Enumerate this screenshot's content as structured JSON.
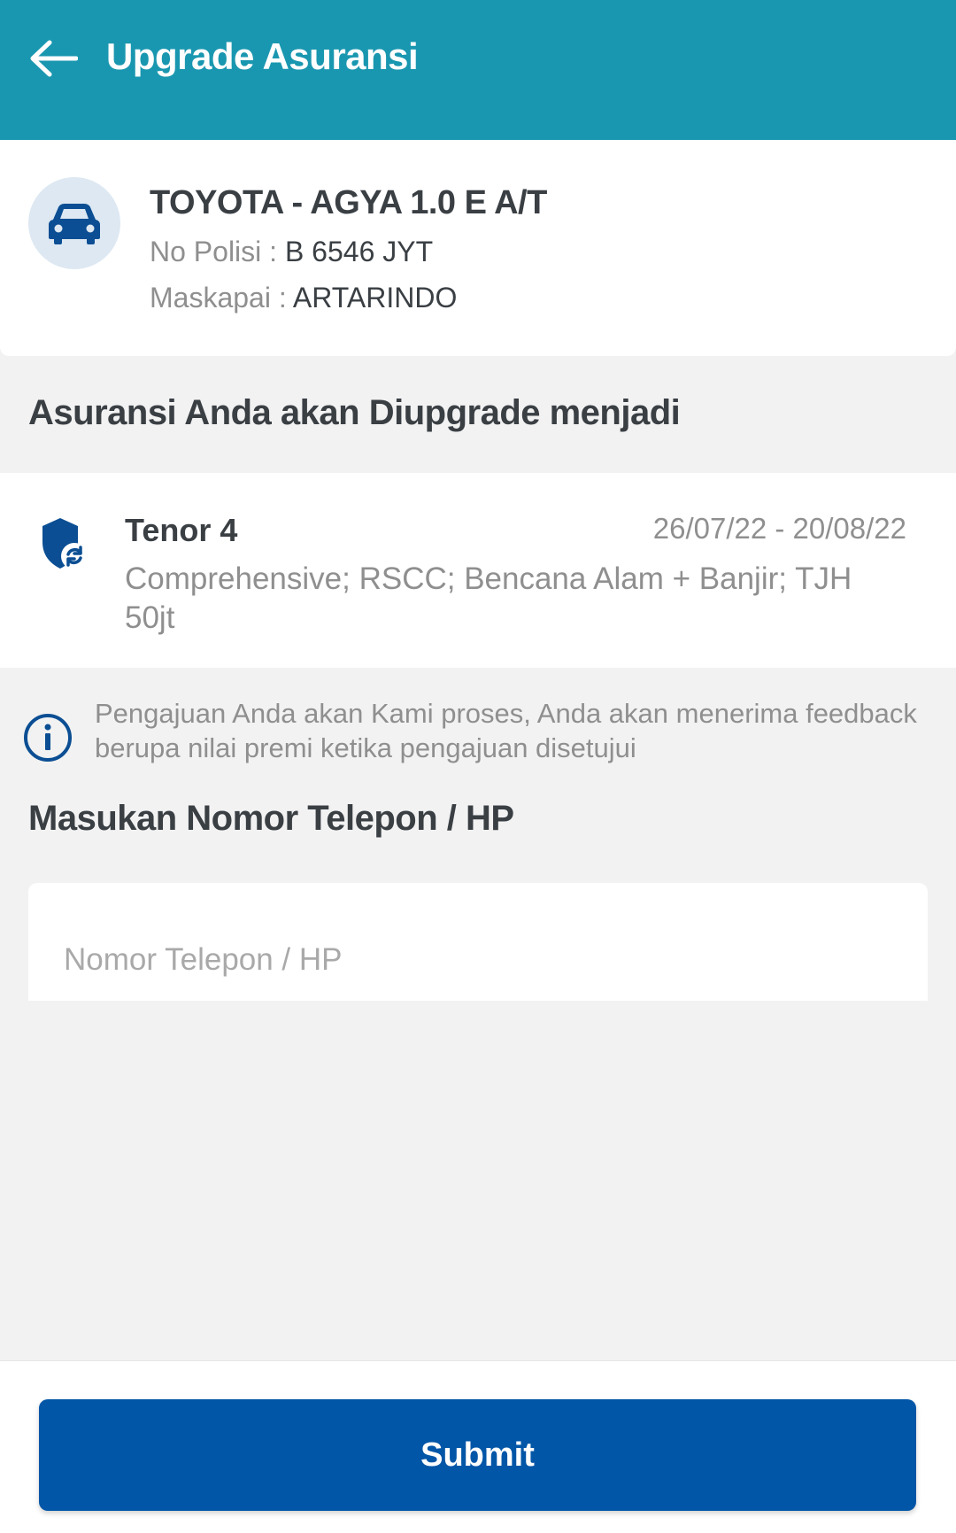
{
  "header": {
    "title": "Upgrade Asuransi",
    "background_color": "#1a97b0"
  },
  "vehicle": {
    "name": "TOYOTA - AGYA 1.0 E A/T",
    "polisi_label": "No Polisi : ",
    "polisi_value": "B 6546 JYT",
    "maskapai_label": "Maskapai : ",
    "maskapai_value": "ARTARINDO",
    "icon": "car-icon"
  },
  "upgrade_section": {
    "title": "Asuransi Anda akan Diupgrade menjadi"
  },
  "plan": {
    "title": "Tenor 4",
    "dates": "26/07/22 - 20/08/22",
    "description": "Comprehensive; RSCC; Bencana Alam + Banjir; TJH 50jt",
    "icon": "shield-refresh-icon"
  },
  "info": {
    "text": "Pengajuan Anda akan Kami proses, Anda akan menerima feedback berupa nilai premi ketika pengajuan disetujui",
    "icon": "info-icon"
  },
  "phone": {
    "label": "Masukan Nomor Telepon / HP",
    "placeholder": "Nomor Telepon / HP",
    "value": ""
  },
  "footer": {
    "submit_label": "Submit",
    "button_color": "#0256a7"
  }
}
